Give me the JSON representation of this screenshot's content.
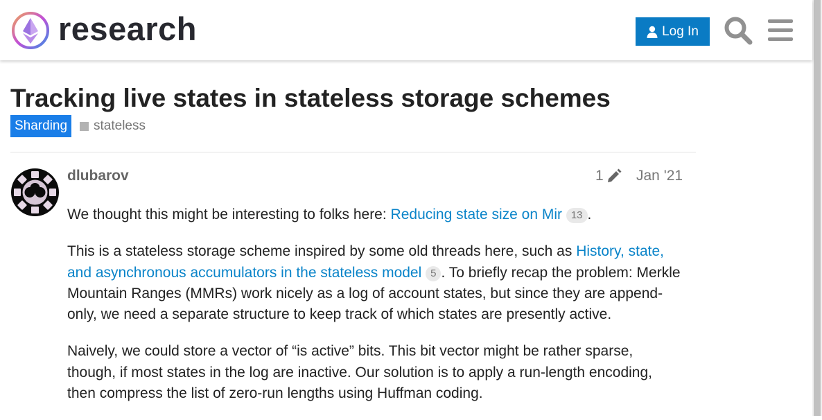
{
  "header": {
    "site_name": "research",
    "login_label": "Log In"
  },
  "topic": {
    "title": "Tracking live states in stateless storage schemes",
    "category": "Sharding",
    "tag": "stateless"
  },
  "post": {
    "author": "dlubarov",
    "edit_count": "1",
    "date": "Jan '21",
    "p1_text": "We thought this might be interesting to folks here: ",
    "p1_link": "Reducing state size on Mir",
    "p1_count": "13",
    "p1_end": ".",
    "p2_text": "This is a stateless storage scheme inspired by some old threads here, such as ",
    "p2_link": "History, state, and asynchronous accumulators in the stateless model",
    "p2_count": "5",
    "p2_rest": ". To briefly recap the problem: Merkle Mountain Ranges (MMRs) work nicely as a log of account states, but since they are append-only, we need a separate structure to keep track of which states are presently active.",
    "p3_text": "Naively, we could store a vector of “is active” bits. This bit vector might be rather sparse, though, if most states in the log are inactive. Our solution is to apply a run-length encoding, then compress the list of zero-run lengths using Huffman coding."
  },
  "colors": {
    "login_button": "#0a7bc4",
    "category_badge": "#1a7ee8",
    "link": "#0a84c9"
  },
  "icons": [
    "logo-icon",
    "user-icon",
    "search-icon",
    "hamburger-menu-icon",
    "pencil-icon",
    "avatar-image"
  ]
}
